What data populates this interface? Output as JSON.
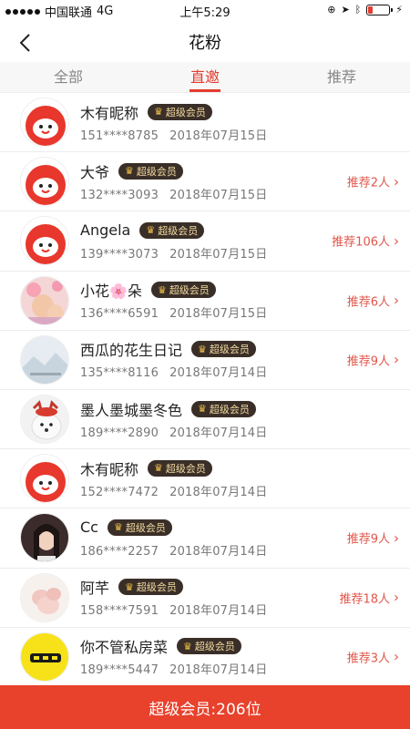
{
  "status_bar": {
    "carrier": "中国联通",
    "network": "4G",
    "time": "上午5:29"
  },
  "nav": {
    "title": "花粉",
    "back_icon": "chevron-left-icon"
  },
  "tabs": [
    {
      "label": "全部",
      "active": false
    },
    {
      "label": "直邀",
      "active": true
    },
    {
      "label": "推荐",
      "active": false
    }
  ],
  "vip_label": "超级会员",
  "members": [
    {
      "name": "木有昵称",
      "phone": "151****8785",
      "date": "2018年07月15日",
      "recommend": "",
      "avatar": "red-mascot"
    },
    {
      "name": "大爷",
      "phone": "132****3093",
      "date": "2018年07月15日",
      "recommend": "推荐2人",
      "avatar": "red-mascot"
    },
    {
      "name": "Angela",
      "phone": "139****3073",
      "date": "2018年07月15日",
      "recommend": "推荐106人",
      "avatar": "red-mascot"
    },
    {
      "name": "小花🌸朵",
      "phone": "136****6591",
      "date": "2018年07月15日",
      "recommend": "推荐6人",
      "avatar": "photo-pink"
    },
    {
      "name": "西瓜的花生日记",
      "phone": "135****8116",
      "date": "2018年07月14日",
      "recommend": "推荐9人",
      "avatar": "photo-landscape"
    },
    {
      "name": "墨人墨城墨冬色",
      "phone": "189****2890",
      "date": "2018年07月14日",
      "recommend": "",
      "avatar": "photo-dog"
    },
    {
      "name": "木有昵称",
      "phone": "152****7472",
      "date": "2018年07月14日",
      "recommend": "",
      "avatar": "red-mascot"
    },
    {
      "name": "Cc",
      "phone": "186****2257",
      "date": "2018年07月14日",
      "recommend": "推荐9人",
      "avatar": "photo-portrait"
    },
    {
      "name": "阿芊",
      "phone": "158****7591",
      "date": "2018年07月14日",
      "recommend": "推荐18人",
      "avatar": "photo-baby"
    },
    {
      "name": "你不管私房菜",
      "phone": "189****5447",
      "date": "2018年07月14日",
      "recommend": "推荐3人",
      "avatar": "yellow-logo"
    }
  ],
  "footer": {
    "text": "超级会员:206位"
  },
  "colors": {
    "accent": "#e63b2e",
    "footer_bg": "#e8412c",
    "badge_bg": "#3a2f28",
    "badge_text": "#f2d9a0"
  }
}
